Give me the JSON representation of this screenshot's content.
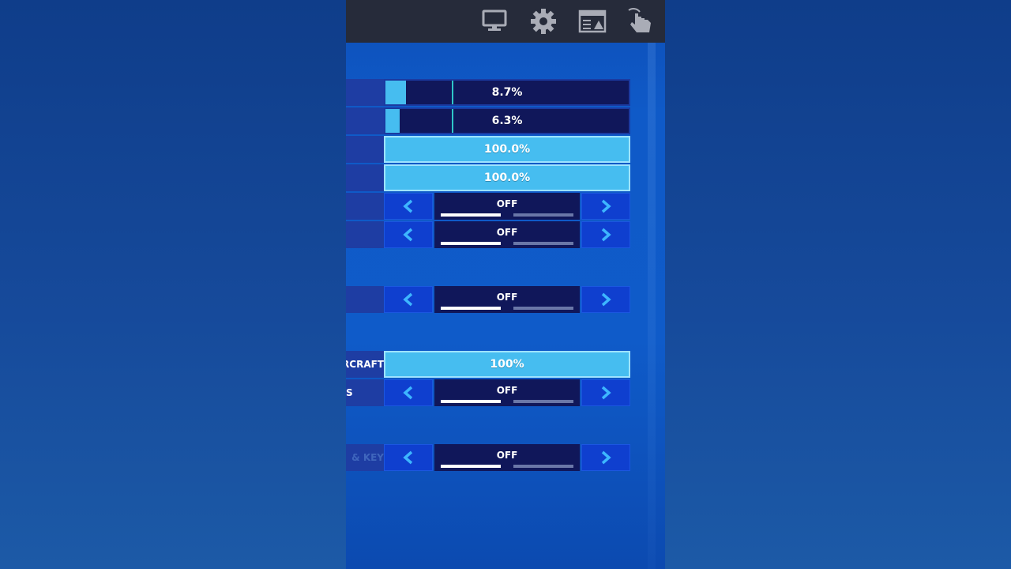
{
  "settings": {
    "rows": [
      {
        "label": "",
        "value": "8.7%",
        "fill": 0.087
      },
      {
        "label": "",
        "value": "6.3%",
        "fill": 0.063
      },
      {
        "label": "",
        "value": "100.0%",
        "fill": 1.0
      },
      {
        "label": "",
        "value": "100.0%",
        "fill": 1.0
      },
      {
        "label": "",
        "value": "OFF"
      },
      {
        "label": "",
        "value": "OFF"
      },
      {
        "label": "",
        "value": "OFF"
      },
      {
        "label": "RCRAFT",
        "value": "100%",
        "fill": 1.0
      },
      {
        "label": "S",
        "value": "OFF"
      },
      {
        "label": "& KEY",
        "value": "OFF"
      }
    ]
  },
  "icons": {
    "topbar": [
      "monitor-icon",
      "gear-icon",
      "hud-layout-icon",
      "touch-icon"
    ]
  },
  "colors": {
    "accent_fill": "#46bdf0",
    "track": "#10175a",
    "arrow_button": "#0f3fcf",
    "topbar": "#262b3a"
  }
}
